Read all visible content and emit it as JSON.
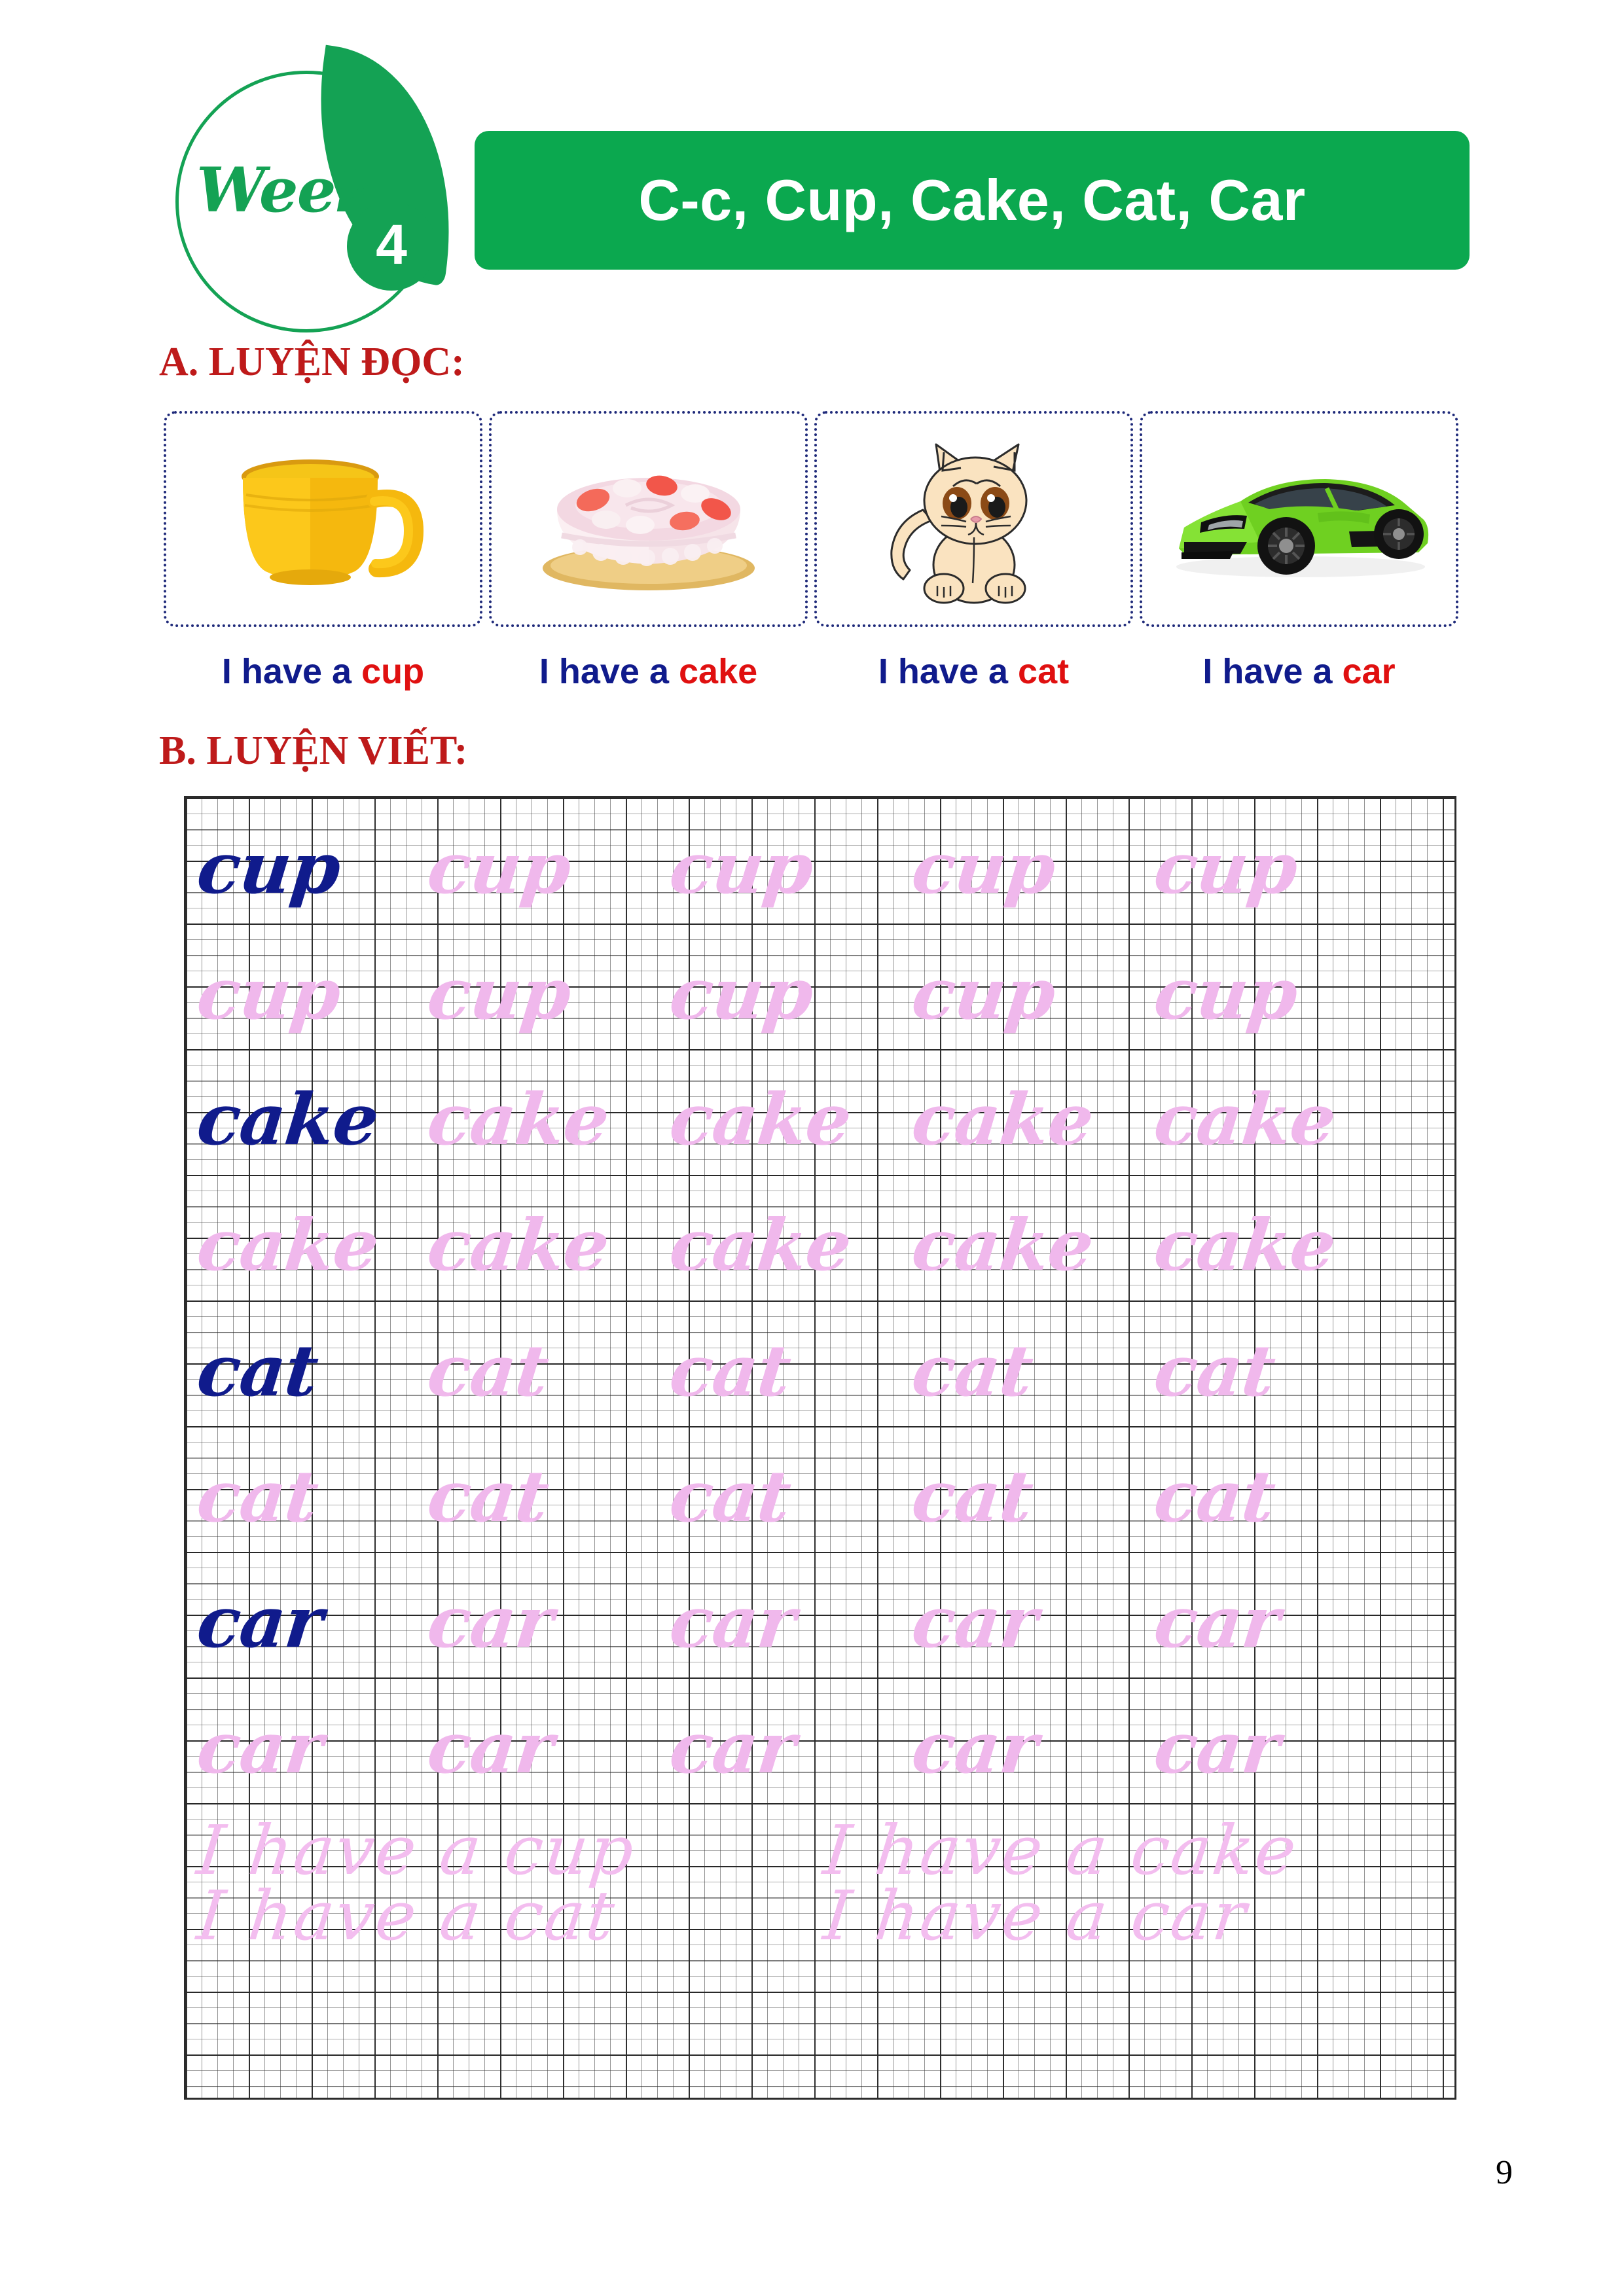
{
  "header": {
    "week_label": "Week",
    "week_number": "4",
    "title": "C-c, Cup, Cake, Cat, Car",
    "brand_green": "#0BA84F"
  },
  "sections": {
    "reading_heading": "A. LUYỆN ĐỌC:",
    "writing_heading": "B. LUYỆN VIẾT:",
    "heading_color": "#BE1A1A"
  },
  "reading": {
    "cards": [
      {
        "icon": "cup-image",
        "alt": "yellow cup"
      },
      {
        "icon": "cake-image",
        "alt": "strawberry cake"
      },
      {
        "icon": "cat-image",
        "alt": "cartoon kitten"
      },
      {
        "icon": "car-image",
        "alt": "green sports car"
      }
    ],
    "captions": [
      {
        "prefix": "I have a ",
        "keyword": "cup"
      },
      {
        "prefix": "I have a ",
        "keyword": "cake"
      },
      {
        "prefix": "I have a ",
        "keyword": "cat"
      },
      {
        "prefix": "I have a ",
        "keyword": "car"
      }
    ],
    "prefix_color": "#101B8C",
    "keyword_color": "#E01010"
  },
  "writing": {
    "model_color": "#101B8C",
    "trace_color": "#F0B8EC",
    "rows": [
      {
        "word": "cup",
        "model": true,
        "copies": 4
      },
      {
        "word": "cup",
        "model": false,
        "copies": 5
      },
      {
        "word": "cake",
        "model": true,
        "copies": 4
      },
      {
        "word": "cake",
        "model": false,
        "copies": 5
      },
      {
        "word": "cat",
        "model": true,
        "copies": 4
      },
      {
        "word": "cat",
        "model": false,
        "copies": 5
      },
      {
        "word": "car",
        "model": true,
        "copies": 4
      },
      {
        "word": "car",
        "model": false,
        "copies": 5
      }
    ],
    "sentence_rows": [
      {
        "left": "I have a cup",
        "right": "I have a cake"
      },
      {
        "left": "I have a cat",
        "right": "I have a car"
      }
    ]
  },
  "footer": {
    "page_number": "9"
  }
}
